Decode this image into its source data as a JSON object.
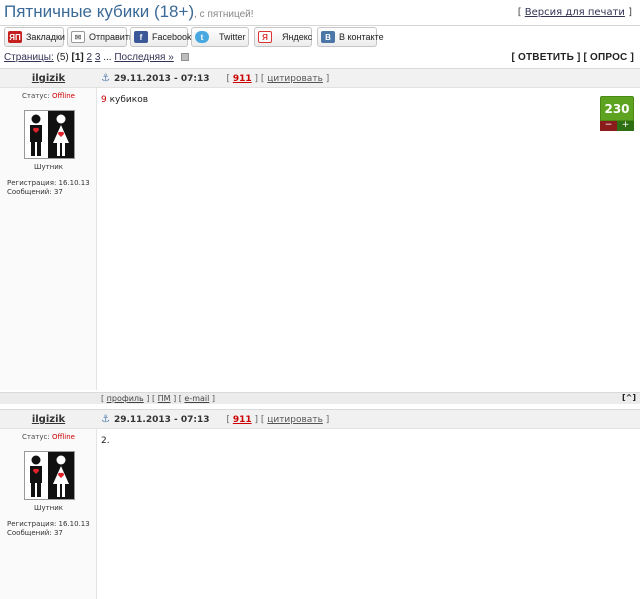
{
  "header": {
    "title": "Пятничные кубики (18+)",
    "subtitle": ", с пятницей!",
    "print_open": "[",
    "print_label": "Версия для печати",
    "print_close": "]"
  },
  "share": [
    {
      "label": "Закладки",
      "icon": "yap-bookmarks-icon",
      "icon_text": "ЯП",
      "color": "#c41e1e"
    },
    {
      "label": "Отправить",
      "icon": "envelope-icon",
      "icon_text": "✉",
      "color": "#8a8a8a"
    },
    {
      "label": "Facebook",
      "icon": "facebook-icon",
      "icon_text": "f",
      "color": "#3b5998"
    },
    {
      "label": "Twitter",
      "icon": "twitter-icon",
      "icon_text": "t",
      "color": "#4aa8e0"
    },
    {
      "label": "Яндекс",
      "icon": "yandex-icon",
      "icon_text": "Я",
      "color": "#d33"
    },
    {
      "label": "В контакте",
      "icon": "vkontakte-icon",
      "icon_text": "B",
      "color": "#4a76a8"
    }
  ],
  "pagination": {
    "label": "Страницы:",
    "total": "(5)",
    "current": "[1]",
    "page2": "2",
    "page3": "3",
    "ellipsis": "...",
    "last": "Последняя »"
  },
  "actions": {
    "reply": "[ ОТВЕТИТЬ ]",
    "poll": "[ ОПРОС ]"
  },
  "posts": [
    {
      "author": "ilgizik",
      "status_label": "Статус:",
      "status": "Offline",
      "rank": "Шутник",
      "reg_label": "Регистрация:",
      "reg_date": "16.10.13",
      "msgs_label": "Сообщений:",
      "msgs": "37",
      "date": "29.11.2013 - 07:13",
      "num": "911",
      "quote": "цитировать",
      "body_num": "9",
      "body_text": " кубиков",
      "rating": "230",
      "minus": "−",
      "plus": "+"
    },
    {
      "author": "ilgizik",
      "status_label": "Статус:",
      "status": "Offline",
      "rank": "Шутник",
      "reg_label": "Регистрация:",
      "reg_date": "16.10.13",
      "msgs_label": "Сообщений:",
      "msgs": "37",
      "date": "29.11.2013 - 07:13",
      "num": "911",
      "quote": "цитировать",
      "body_num": "",
      "body_text": "2."
    }
  ],
  "footer": {
    "profile": "профиль",
    "pm": "ПМ",
    "email": "e-mail",
    "top": "[^]"
  }
}
